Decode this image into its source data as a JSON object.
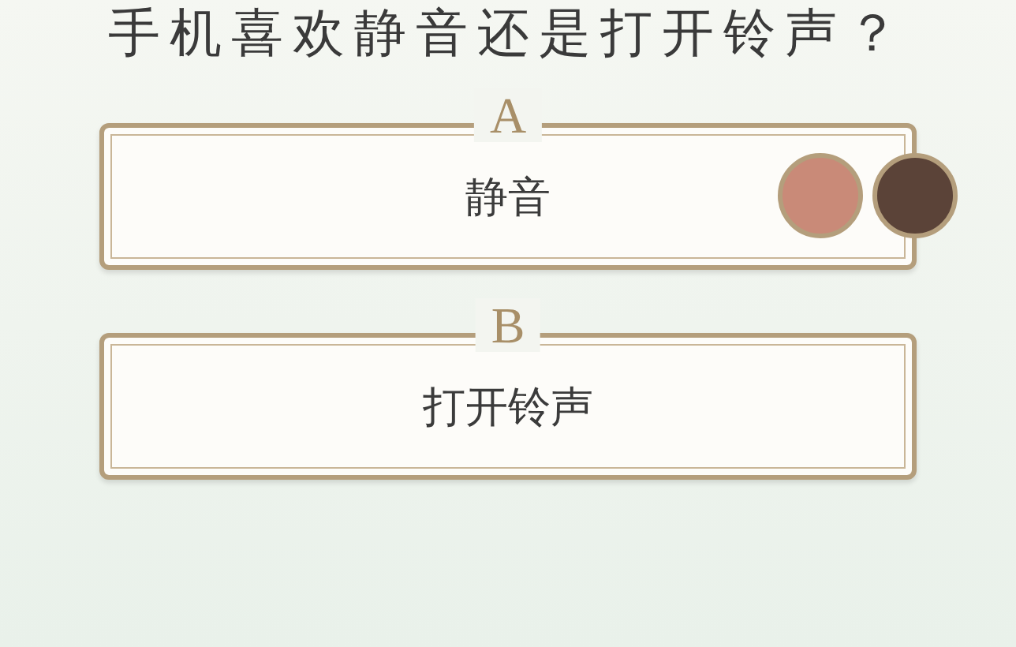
{
  "question": "手机喜欢静音还是打开铃声？",
  "options": [
    {
      "letter": "A",
      "text": "静音",
      "voters": [
        {
          "color": "#c98a78"
        },
        {
          "color": "#5b4338"
        }
      ]
    },
    {
      "letter": "B",
      "text": "打开铃声"
    }
  ]
}
